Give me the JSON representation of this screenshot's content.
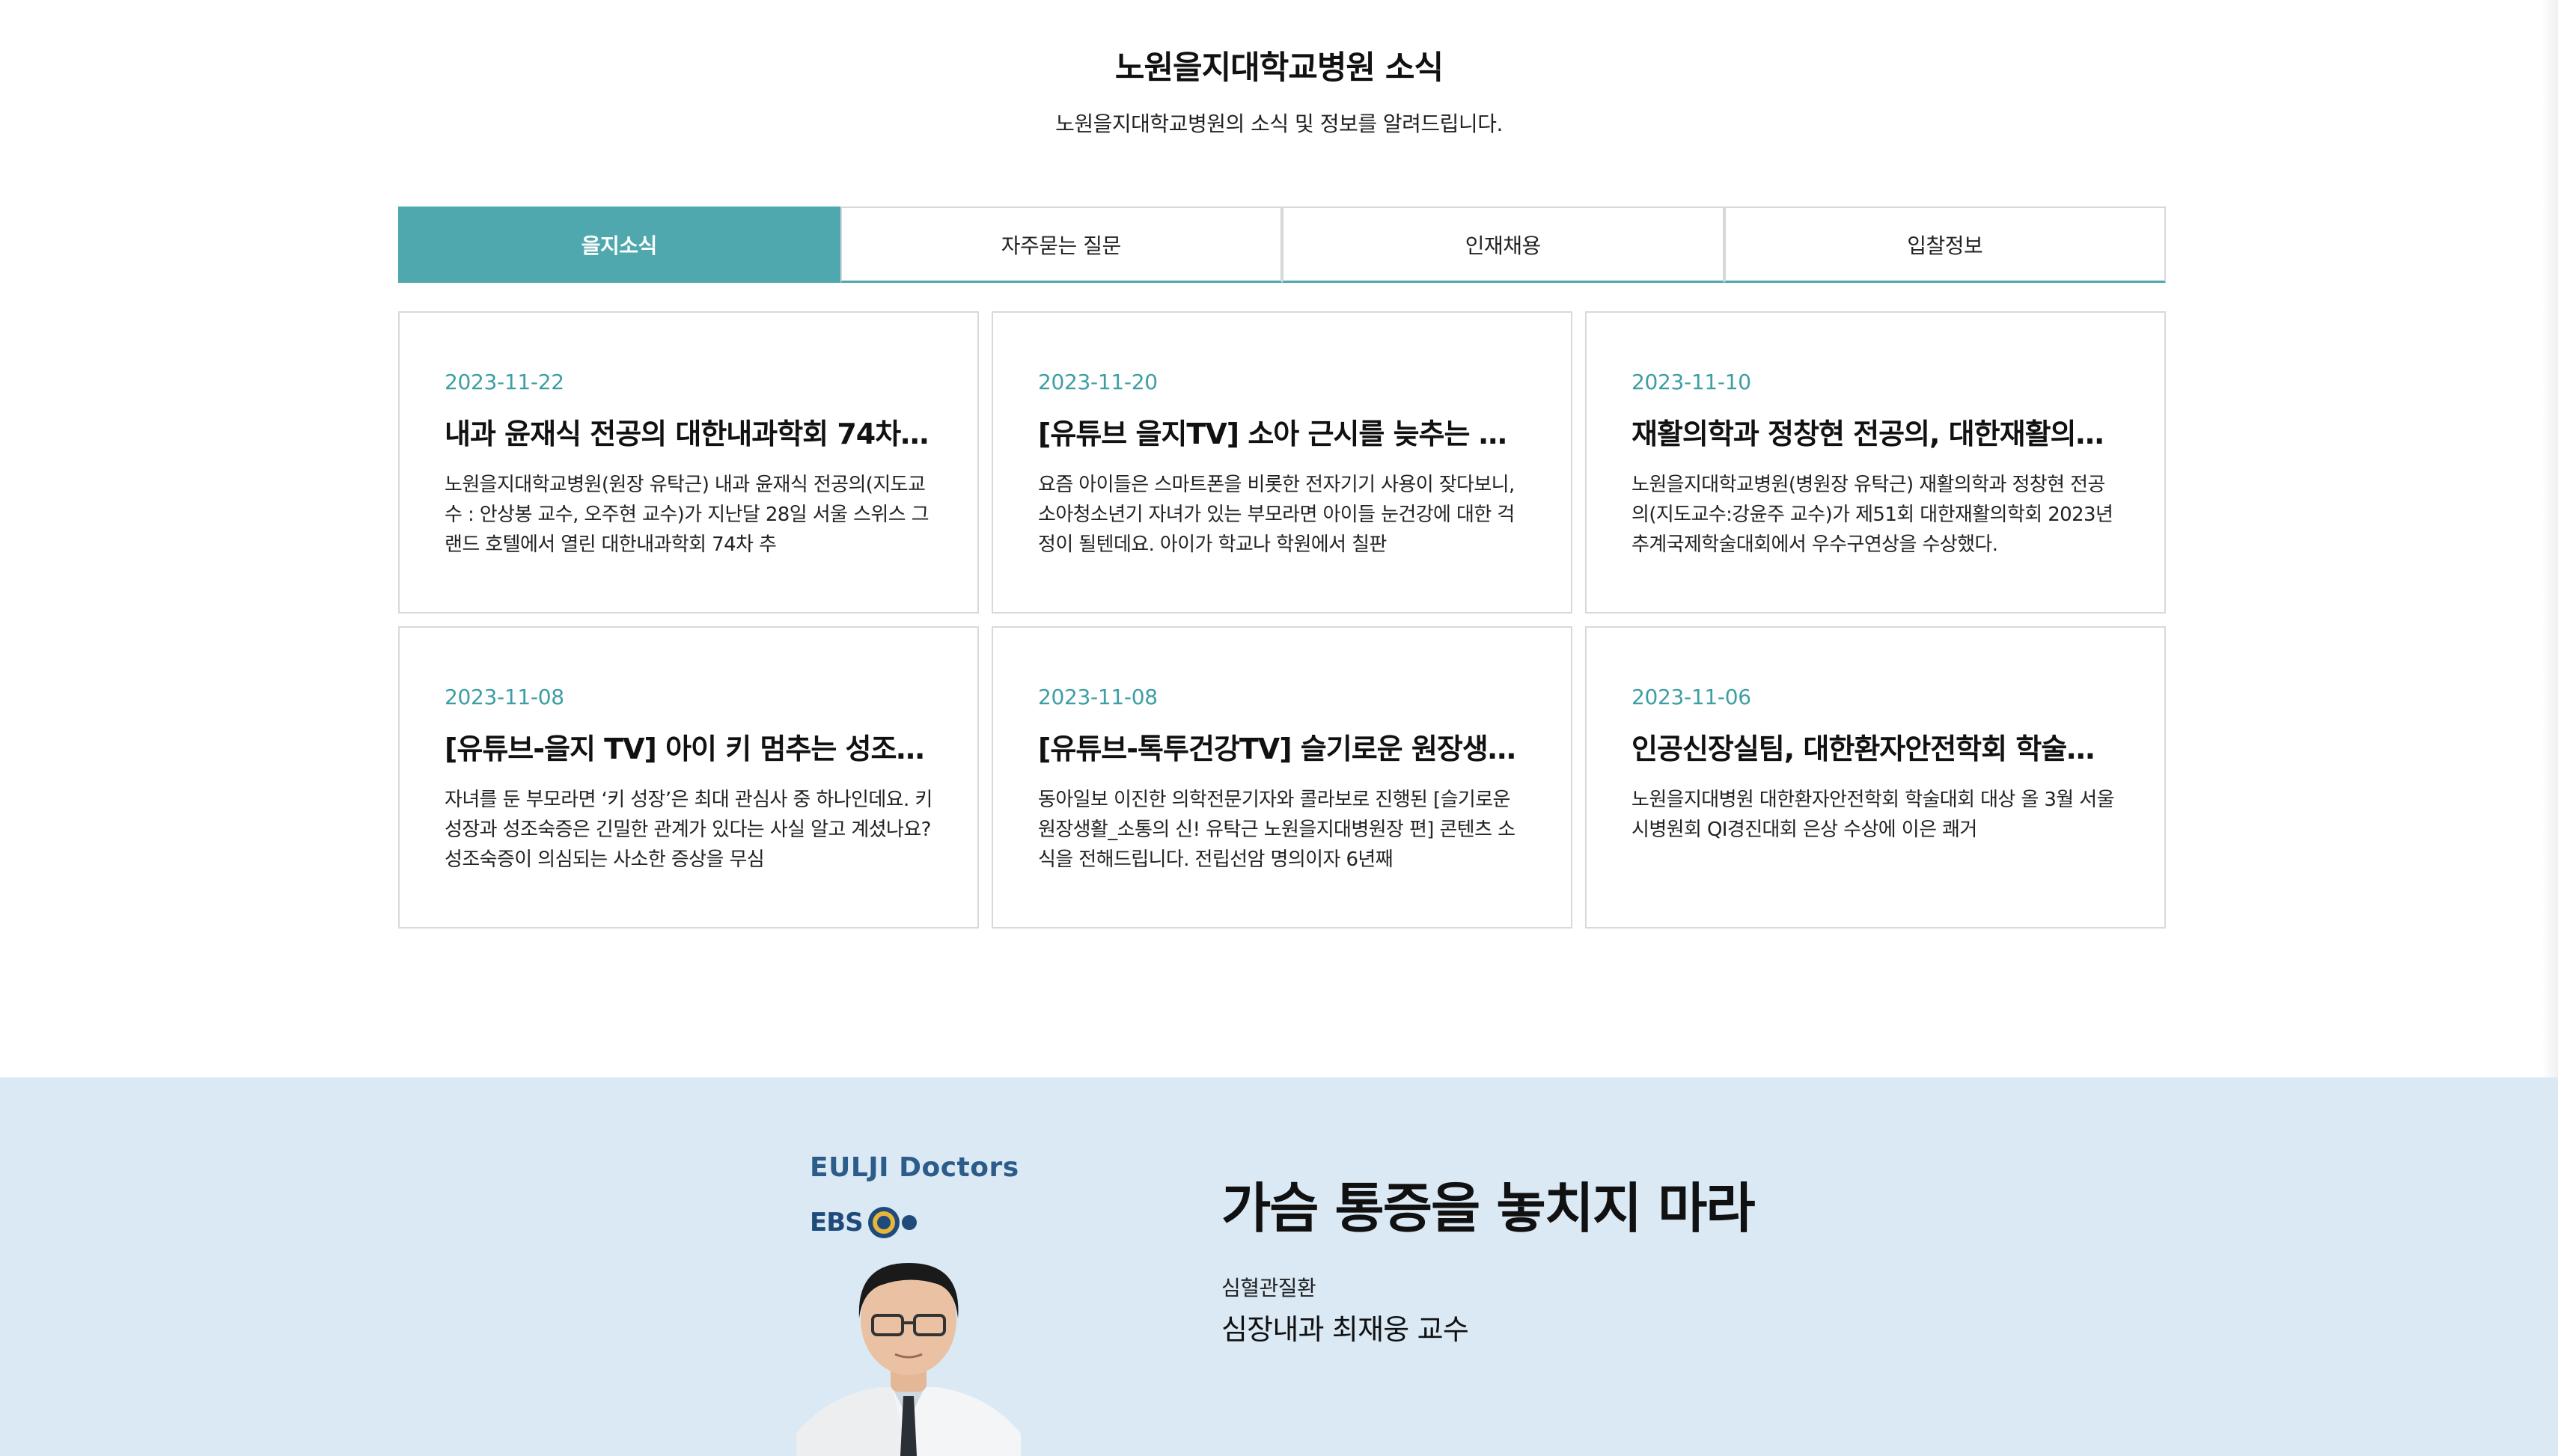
{
  "header": {
    "title": "노원을지대학교병원 소식",
    "subtitle": "노원을지대학교병원의 소식 및 정보를 알려드립니다."
  },
  "tabs": [
    {
      "label": "을지소식",
      "active": true
    },
    {
      "label": "자주묻는 질문",
      "active": false
    },
    {
      "label": "인재채용",
      "active": false
    },
    {
      "label": "입찰정보",
      "active": false
    }
  ],
  "news": [
    {
      "date": "2023-11-22",
      "title": "내과 윤재식 전공의 대한내과학회 74차 …",
      "body": "노원을지대학교병원(원장 유탁근) 내과 윤재식 전공의(지도교수 : 안상봉 교수, 오주현 교수)가 지난달 28일 서울 스위스 그랜드 호텔에서 열린 대한내과학회 74차 추"
    },
    {
      "date": "2023-11-20",
      "title": "[유튜브 을지TV] 소아 근시를 늦추는 드…",
      "body": "요즘 아이들은 스마트폰을 비롯한 전자기기 사용이 잦다보니, 소아청소년기 자녀가 있는 부모라면 아이들 눈건강에 대한 걱정이 될텐데요. 아이가 학교나 학원에서 칠판"
    },
    {
      "date": "2023-11-10",
      "title": "재활의학과 정창현 전공의, 대한재활의…",
      "body": "노원을지대학교병원(병원장 유탁근) 재활의학과 정창현 전공의(지도교수:강윤주 교수)가 제51회 대한재활의학회 2023년 추계국제학술대회에서 우수구연상을 수상했다."
    },
    {
      "date": "2023-11-08",
      "title": "[유튜브-을지 TV] 아이 키 멈추는 성조…",
      "body": "자녀를 둔 부모라면 ‘키 성장’은 최대 관심사 중 하나인데요. 키 성장과 성조숙증은 긴밀한 관계가 있다는 사실 알고 계셨나요? 성조숙증이 의심되는 사소한 증상을 무심"
    },
    {
      "date": "2023-11-08",
      "title": "[유튜브-톡투건강TV] 슬기로운 원장생…",
      "body": "동아일보 이진한 의학전문기자와 콜라보로 진행된 [슬기로운 원장생활_소통의 신! 유탁근 노원을지대병원장 편] 콘텐츠 소식을 전해드립니다. 전립선암 명의이자 6년째"
    },
    {
      "date": "2023-11-06",
      "title": "인공신장실팀, 대한환자안전학회 학술…",
      "body": "노원을지대병원 대한환자안전학회 학술대회 대상 올 3월 서울시병원회 QI경진대회 은상 수상에 이은 쾌거"
    }
  ],
  "video": {
    "brand": "EULJI Doctors",
    "ebs_label": "EBS",
    "title": "가슴 통증을 놓치지 마라",
    "category": "심혈관질환",
    "doctor": "심장내과 최재웅 교수"
  },
  "colors": {
    "accent": "#4ea8ad",
    "date": "#3e9ea3",
    "video_bg": "#dbe9f5",
    "brand": "#2b5c8a"
  }
}
